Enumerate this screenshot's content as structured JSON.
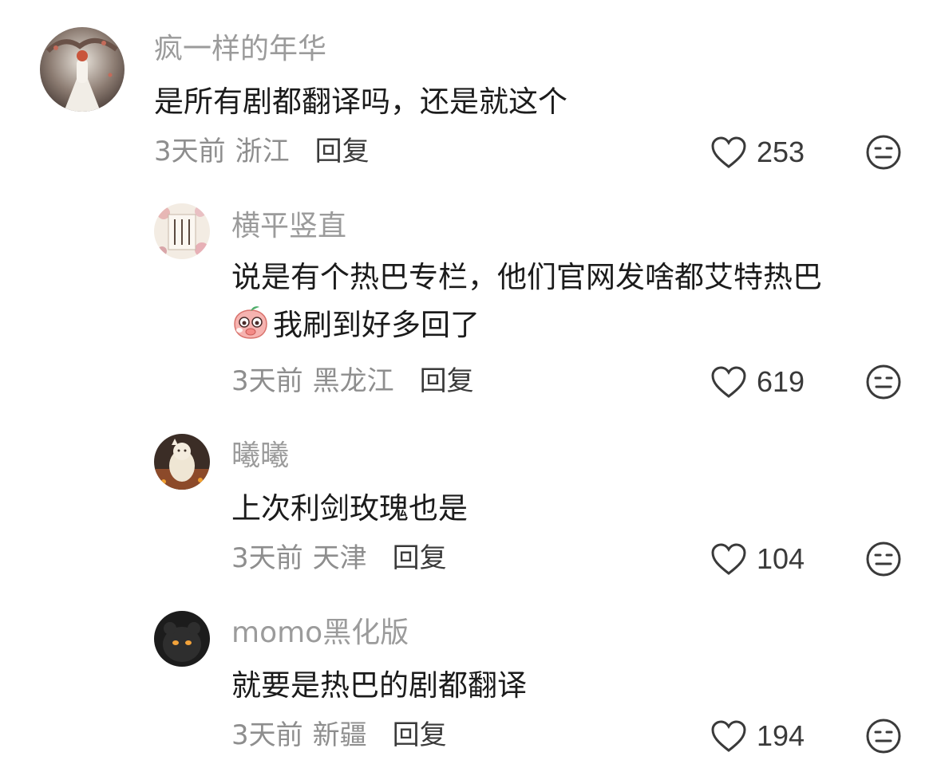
{
  "comments": [
    {
      "username": "疯一样的年华",
      "lines": [
        "是所有剧都翻译吗，还是就这个"
      ],
      "time": "3天前",
      "region": "浙江",
      "reply": "回复",
      "likes": "253"
    },
    {
      "username": "横平竖直",
      "lines": [
        "说是有个热巴专栏，他们官网发啥都艾特热巴",
        "我刷到好多回了"
      ],
      "time": "3天前",
      "region": "黑龙江",
      "reply": "回复",
      "likes": "619"
    },
    {
      "username": "曦曦",
      "lines": [
        "上次利剑玫瑰也是"
      ],
      "time": "3天前",
      "region": "天津",
      "reply": "回复",
      "likes": "104"
    },
    {
      "username": "momo黑化版",
      "lines": [
        "就要是热巴的剧都翻译"
      ],
      "time": "3天前",
      "region": "新疆",
      "reply": "回复",
      "likes": "194"
    }
  ],
  "colors": {
    "username": "#9b9b9b",
    "text": "#1b1b1b",
    "meta": "#8e8e8e",
    "icon": "#3a3a3a"
  }
}
